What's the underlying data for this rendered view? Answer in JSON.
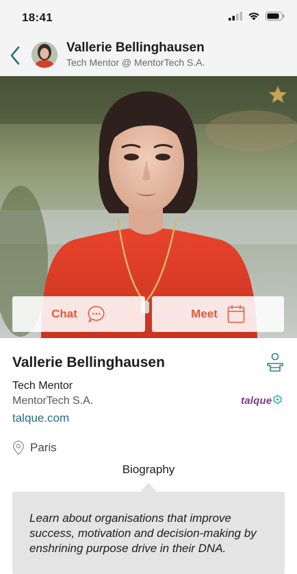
{
  "status_bar": {
    "time": "18:41"
  },
  "header": {
    "name": "Vallerie Bellinghausen",
    "subtitle": "Tech Mentor @ MentorTech S.A."
  },
  "actions": {
    "chat_label": "Chat",
    "meet_label": "Meet"
  },
  "profile": {
    "name": "Vallerie Bellinghausen",
    "role": "Tech Mentor",
    "company": "MentorTech S.A.",
    "website": "talque.com",
    "location": "Paris",
    "logo_text": "talque"
  },
  "biography": {
    "title": "Biography",
    "text": "Learn about organisations that improve success, motivation and decision-making by enshrining purpose drive in their DNA."
  },
  "colors": {
    "accent": "#e35a3c",
    "link": "#2d6a8a",
    "teal_icon": "#2a7f8f",
    "logo": "#7a3a86"
  }
}
